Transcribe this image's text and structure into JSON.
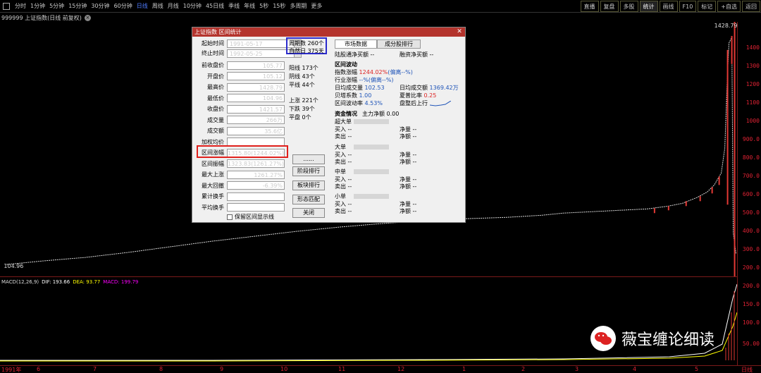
{
  "toolbar": {
    "periods": [
      "分时",
      "1分钟",
      "5分钟",
      "15分钟",
      "30分钟",
      "60分钟",
      "日线",
      "周线",
      "月线",
      "10分钟",
      "45日线",
      "季线",
      "年线",
      "5秒",
      "15秒",
      "多周期",
      "更多"
    ],
    "active_period": "日线",
    "right_tools": [
      "直播",
      "复盘",
      "多股",
      "统计",
      "画线",
      "F10",
      "标记",
      "+自选",
      "返回"
    ],
    "active_right": "统计"
  },
  "info": {
    "code_name": "999999 上证指数(日线 前复权)"
  },
  "price_axis": {
    "ticks": [
      "1400",
      "1300",
      "1200",
      "1100",
      "1000",
      "900.0",
      "800.0",
      "700.0",
      "600.0",
      "500.0",
      "400.0",
      "300.0",
      "200.0"
    ],
    "high_label": "1428.79",
    "low_label": "104.96"
  },
  "macd": {
    "label": "MACD(12,26,9)",
    "dif": "DIF: 193.66",
    "dea": "DEA: 93.77",
    "macd": "MACD: 199.79",
    "ticks": [
      "200.0",
      "150.0",
      "100.0",
      "50.00"
    ]
  },
  "date_axis": {
    "labels": [
      "1991年",
      "6",
      "7",
      "8",
      "9",
      "10",
      "11",
      "12",
      "1",
      "2",
      "3",
      "4",
      "5",
      "日线"
    ]
  },
  "dialog": {
    "title": "上证指数 区间统计",
    "start_label": "起始时间",
    "start_value": "1991-05-17",
    "end_label": "终止时间",
    "end_value": "1992-05-25",
    "fields": [
      {
        "label": "前收盘价",
        "value": "105.77"
      },
      {
        "label": "开盘价",
        "value": "105.12"
      },
      {
        "label": "最高价",
        "value": "1428.79"
      },
      {
        "label": "最低价",
        "value": "104.96"
      },
      {
        "label": "收盘价",
        "value": "1421.57"
      },
      {
        "label": "成交量",
        "value": "266万"
      },
      {
        "label": "成交额",
        "value": "35.6亿"
      },
      {
        "label": "加权均价",
        "value": ""
      },
      {
        "label": "区间涨幅",
        "value": "1315.80(1244.02%)"
      },
      {
        "label": "区间振幅",
        "value": "1323.83(1261.27%)"
      },
      {
        "label": "最大上涨",
        "value": "1261.27%"
      },
      {
        "label": "最大回撤",
        "value": "-6.39%"
      },
      {
        "label": "累计换手",
        "value": ""
      },
      {
        "label": "平均换手",
        "value": ""
      }
    ],
    "period_count": "周期数 260个",
    "natural_days": "自然日 375天",
    "yang": "阳线 173个",
    "yin": "阴线 43个",
    "ping": "平线 44个",
    "up": "上涨 221个",
    "down": "下跌 39个",
    "flat": "平盘 0个",
    "buttons": {
      "more": "......",
      "stage": "阶段排行",
      "sector": "板块排行",
      "pattern": "形态匹配",
      "close": "关闭"
    },
    "keep_label": "保留区间显示线",
    "tabs": [
      "市场数据",
      "成分股排行"
    ],
    "hk_net": "陆股通净买额 --",
    "margin_net": "融资净买额 --",
    "volatility_title": "区间波动",
    "index_change_lbl": "指数涨幅",
    "index_change_val": "1244.02%",
    "index_change_dev": "(偏离--%)",
    "industry_change_lbl": "行业涨幅",
    "industry_change_val": "--%(偏离--%)",
    "avg_vol_lbl": "日均成交量",
    "avg_vol_val": "102.53",
    "avg_amt_lbl": "日均成交额",
    "avg_amt_val": "1369.42万",
    "beta_lbl": "贝塔系数",
    "beta_val": "1.00",
    "sharpe_lbl": "夏普比率",
    "sharpe_val": "0.25",
    "vol_rate_lbl": "区间波动率",
    "vol_rate_val": "4.53%",
    "trend_lbl": "盘整后上行",
    "fund_title": "资金情况",
    "main_net": "主力净额 0.00",
    "groups": [
      {
        "name": "超大单",
        "buy": "买入 --",
        "sell": "卖出 --",
        "net": "净量 --",
        "amt": "净额 --"
      },
      {
        "name": "大单",
        "buy": "买入 --",
        "sell": "卖出 --",
        "net": "净量 --",
        "amt": "净额 --"
      },
      {
        "name": "中单",
        "buy": "买入 --",
        "sell": "卖出 --",
        "net": "净量 --",
        "amt": "净额 --"
      },
      {
        "name": "小单",
        "buy": "买入 --",
        "sell": "卖出 --",
        "net": "净量 --",
        "amt": "净额 --"
      }
    ]
  },
  "watermark": {
    "text": "薇宝缠论细读"
  }
}
